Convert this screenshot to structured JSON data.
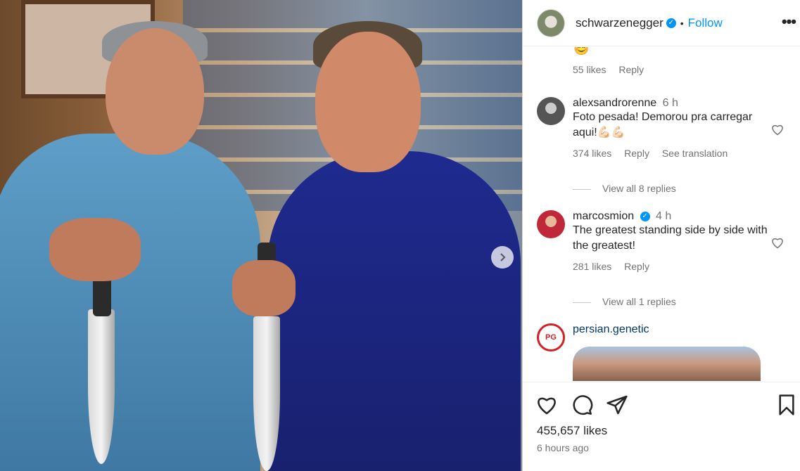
{
  "header": {
    "username": "schwarzenegger",
    "follow_label": "Follow",
    "dot": "•",
    "more_label": "•••"
  },
  "top_comment_meta": {
    "emoji": "😊",
    "likes": "55 likes",
    "reply": "Reply"
  },
  "comments": [
    {
      "username": "alexsandrorenne",
      "time": "6 h",
      "text": "Foto pesada! Demorou pra carregar aqui!💪🏻💪🏻",
      "likes": "374 likes",
      "reply": "Reply",
      "translation": "See translation",
      "view_replies": "View all 8 replies"
    },
    {
      "username": "marcosmion",
      "verified": true,
      "time": "4 h",
      "text": "The greatest standing side by side with the greatest!",
      "likes": "281 likes",
      "reply": "Reply",
      "view_replies": "View all 1 replies"
    },
    {
      "username": "persian.genetic",
      "avatar_text": "PG"
    }
  ],
  "post": {
    "likes": "455,657 likes",
    "time_ago": "6 hours ago"
  },
  "colors": {
    "accent": "#0095f6",
    "muted": "#737373",
    "text": "#262626"
  }
}
